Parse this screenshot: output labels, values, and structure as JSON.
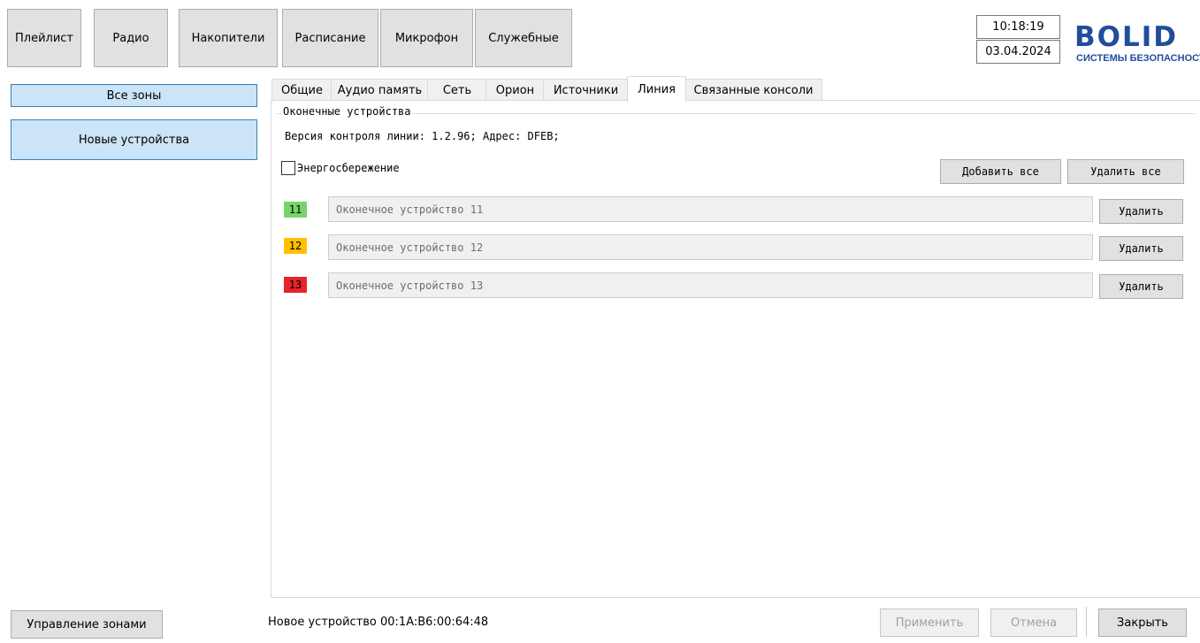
{
  "toolbar": {
    "buttons": [
      "Плейлист",
      "Радио",
      "Накопители",
      "Расписание",
      "Микрофон",
      "Служебные"
    ]
  },
  "clock": {
    "time": "10:18:19",
    "date": "03.04.2024"
  },
  "logo": {
    "word": "BOLID",
    "subtitle": "СИСТЕМЫ БЕЗОПАСНОСТ"
  },
  "sidebar": {
    "all_zones": "Все зоны",
    "new_devices": "Новые устройства"
  },
  "tabs": [
    "Общие",
    "Аудио память",
    "Сеть",
    "Орион",
    "Источники",
    "Линия",
    "Связанные консоли"
  ],
  "active_tab": "Линия",
  "group": {
    "title": "Оконечные устройства",
    "version_text": "Версия контроля линии: 1.2.96; Адрес: DFEB;",
    "energy_saving_label": "Энергосбережение",
    "energy_saving_checked": false,
    "add_all": "Добавить все",
    "delete_all": "Удалить все"
  },
  "devices": [
    {
      "num": "11",
      "name": "Оконечное устройство 11",
      "delete": "Удалить",
      "color": "#76d46b"
    },
    {
      "num": "12",
      "name": "Оконечное устройство 12",
      "delete": "Удалить",
      "color": "#ffc000"
    },
    {
      "num": "13",
      "name": "Оконечное устройство 13",
      "delete": "Удалить",
      "color": "#e8232a"
    }
  ],
  "footer": {
    "manage_zones": "Управление зонами",
    "status": "Новое устройство 00:1A:B6:00:64:48",
    "apply": "Применить",
    "cancel": "Отмена",
    "close": "Закрыть"
  }
}
